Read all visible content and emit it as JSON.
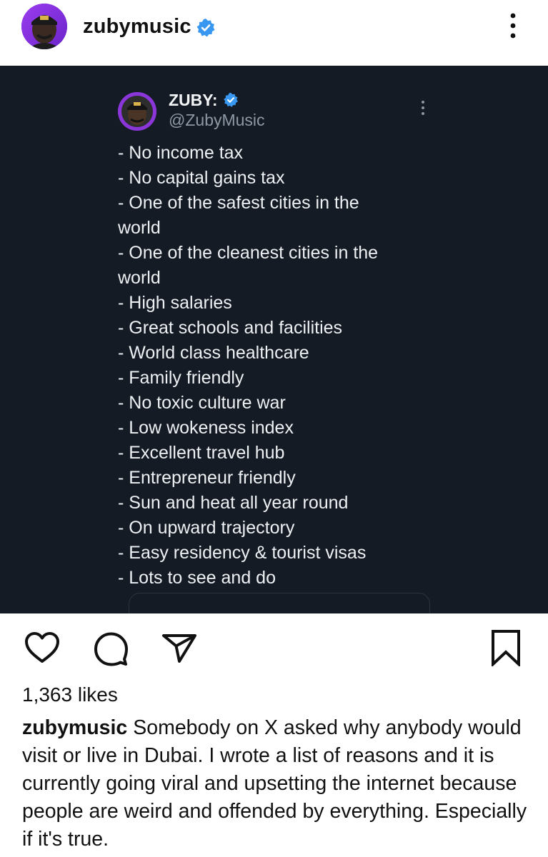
{
  "post": {
    "username": "zubymusic",
    "verified": true,
    "accent_color": "#3897f0"
  },
  "tweet": {
    "name": "ZUBY:",
    "handle": "@ZubyMusic",
    "lines": [
      "- No income tax",
      "- No capital gains tax",
      "- One of the safest cities in the",
      "world",
      "- One of the cleanest cities in the",
      "world",
      "- High salaries",
      "- Great schools and facilities",
      "- World class healthcare",
      "- Family friendly",
      "- No toxic culture war",
      "- Low wokeness index",
      "- Excellent travel hub",
      "- Entrepreneur friendly",
      "- Sun and heat all year round",
      "- On upward trajectory",
      "- Easy residency & tourist visas",
      "- Lots to see and do"
    ],
    "background_color": "#151b24"
  },
  "actions": {
    "like_icon": "heart-outline",
    "comment_icon": "speech-bubble",
    "share_icon": "paper-plane",
    "save_icon": "bookmark"
  },
  "likes": "1,363 likes",
  "caption": {
    "username": "zubymusic",
    "text": "Somebody on X asked why anybody would visit or live in Dubai. I wrote a list of reasons and it is currently going viral and upsetting the internet because people are weird and offended by everything. Especially if it's true."
  }
}
